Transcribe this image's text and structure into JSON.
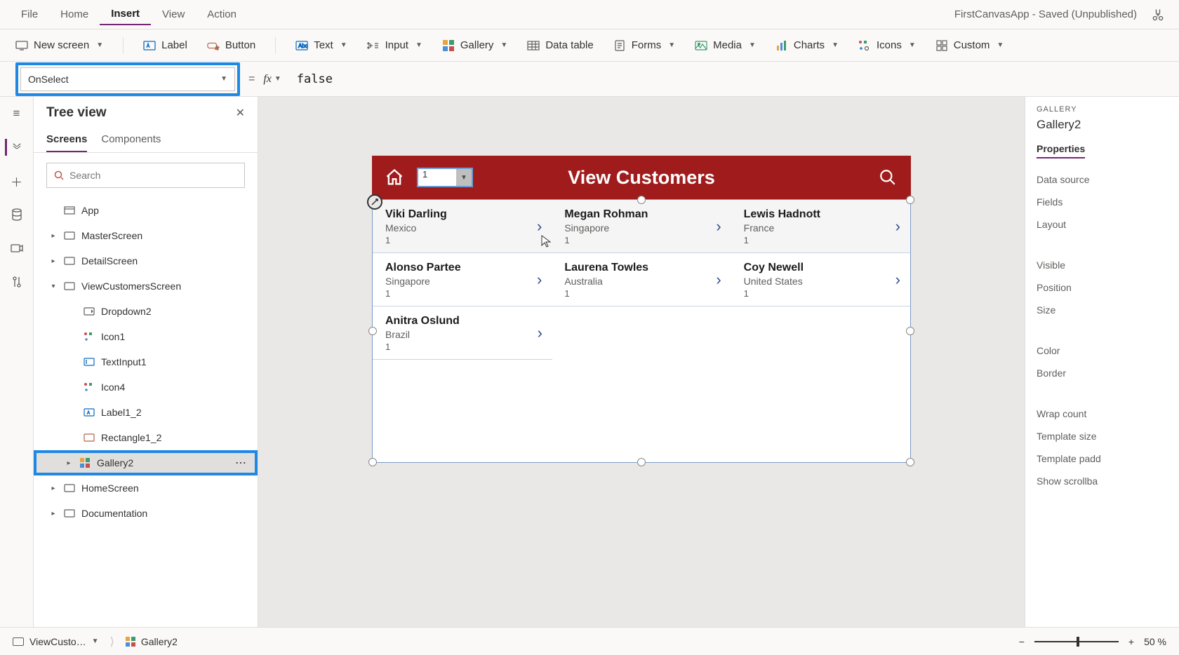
{
  "menubar": {
    "items": [
      "File",
      "Home",
      "Insert",
      "View",
      "Action"
    ],
    "active_index": 2,
    "app_title": "FirstCanvasApp - Saved (Unpublished)"
  },
  "ribbon": {
    "new_screen": "New screen",
    "label": "Label",
    "button": "Button",
    "text": "Text",
    "input": "Input",
    "gallery": "Gallery",
    "data_table": "Data table",
    "forms": "Forms",
    "media": "Media",
    "charts": "Charts",
    "icons": "Icons",
    "custom": "Custom"
  },
  "formula": {
    "property": "OnSelect",
    "value": "false"
  },
  "tree": {
    "title": "Tree view",
    "tabs": [
      "Screens",
      "Components"
    ],
    "search_placeholder": "Search",
    "nodes": {
      "app": "App",
      "master": "MasterScreen",
      "detail": "DetailScreen",
      "viewcust": "ViewCustomersScreen",
      "dropdown": "Dropdown2",
      "icon1": "Icon1",
      "textinput": "TextInput1",
      "icon4": "Icon4",
      "label12": "Label1_2",
      "rect12": "Rectangle1_2",
      "gallery2": "Gallery2",
      "home": "HomeScreen",
      "docs": "Documentation"
    }
  },
  "canvas": {
    "header_title": "View Customers",
    "dropdown_value": "1",
    "customers": [
      {
        "name": "Viki  Darling",
        "country": "Mexico",
        "num": "1"
      },
      {
        "name": "Megan  Rohman",
        "country": "Singapore",
        "num": "1"
      },
      {
        "name": "Lewis  Hadnott",
        "country": "France",
        "num": "1"
      },
      {
        "name": "Alonso  Partee",
        "country": "Singapore",
        "num": "1"
      },
      {
        "name": "Laurena  Towles",
        "country": "Australia",
        "num": "1"
      },
      {
        "name": "Coy  Newell",
        "country": "United States",
        "num": "1"
      },
      {
        "name": "Anitra  Oslund",
        "country": "Brazil",
        "num": "1"
      }
    ]
  },
  "properties": {
    "category": "GALLERY",
    "name": "Gallery2",
    "tab": "Properties",
    "rows": [
      "Data source",
      "Fields",
      "Layout",
      "Visible",
      "Position",
      "Size",
      "Color",
      "Border",
      "Wrap count",
      "Template size",
      "Template padd",
      "Show scrollba"
    ]
  },
  "status": {
    "crumb1": "ViewCusto…",
    "crumb2": "Gallery2",
    "zoom": "50  %"
  }
}
